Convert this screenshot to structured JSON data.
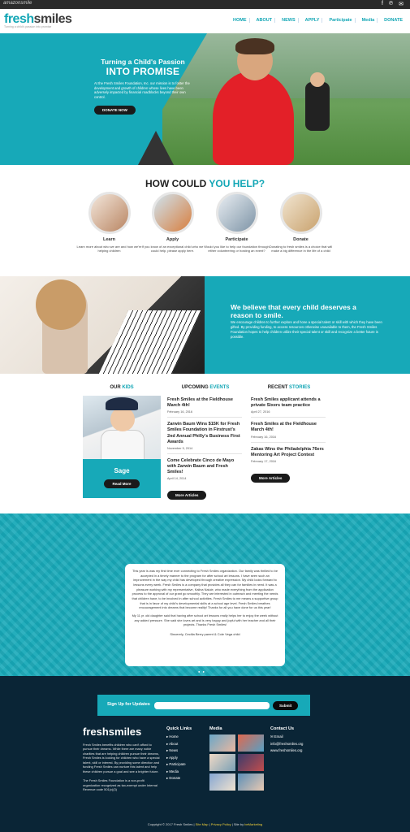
{
  "topbar": {
    "brand": "amazonsmile",
    "social": [
      "f",
      "℗",
      "✉"
    ]
  },
  "logo": {
    "word_a": "fresh",
    "word_b": "smiles",
    "tagline": "Turning a child's passion into promise"
  },
  "nav": [
    "HOME",
    "ABOUT",
    "NEWS",
    "APPLY",
    "Participate",
    "Media",
    "DONATE"
  ],
  "hero": {
    "line1": "Turning a Child's Passion",
    "line2": "INTO PROMISE",
    "body": "At the Fresh Smiles Foundation, Inc. our mission is to foster the development and growth of children whose lives have been adversely impacted by financial roadblocks beyond their own control.",
    "button": "DONATE NOW"
  },
  "help": {
    "title_a": "HOW COULD ",
    "title_b": "YOU HELP?",
    "items": [
      {
        "label": "Learn",
        "desc": "Learn more about who we are and how we're helping children"
      },
      {
        "label": "Apply",
        "desc": "If you know of an exceptional child who we could help, please apply here."
      },
      {
        "label": "Participate",
        "desc": "Would you like to help our foundation through either volunteering or hosting an event?"
      },
      {
        "label": "Donate",
        "desc": "Donating to fresh smiles is a choice that will make a big difference in the life of a child"
      }
    ]
  },
  "believe": {
    "heading": "We believe that every child deserves a reason to smile.",
    "body": "We encourage children to further explore and hone a special talent or skill with which they have been gifted. By providing funding, to access resources otherwise unavailable to them, the Fresh Smiles Foundation hopes to help children utilize their special talent or skill and recognize a better future is possible."
  },
  "news": {
    "kids_title_a": "OUR ",
    "kids_title_b": "KIDS",
    "kid_name": "Sage",
    "kid_button": "Read More",
    "events_title_a": "UPCOMING ",
    "events_title_b": "EVENTS",
    "events": [
      {
        "title": "Fresh Smiles at the Fieldhouse March 4th!",
        "date": "February 16, 2016"
      },
      {
        "title": "Zarwin Baum Wins $15K for Fresh Smiles Foundation in Firstrust's 2nd Annual Philly's Business First Awards",
        "date": "November 5, 2014"
      },
      {
        "title": "Come Celebrate Cinco de Mayo with Zarwin Baum and Fresh Smiles!",
        "date": "April 14, 2014"
      }
    ],
    "events_button": "More Articles",
    "stories_title_a": "RECENT ",
    "stories_title_b": "STORIES",
    "stories": [
      {
        "title": "Fresh Smiles applicant attends a private Sixers team practice",
        "date": "April 27, 2016"
      },
      {
        "title": "Fresh Smiles at the Fieldhouse March 4th!",
        "date": "February 16, 2016"
      },
      {
        "title": "Zakas Wins the Philadelphia 76ers Mentoring Art Project Contest",
        "date": "February 17, 2016"
      }
    ],
    "stories_button": "More Articles"
  },
  "testimonial": {
    "quote1": "This year is was my first time ever connecting to Fresh Smiles organization. Our family was thrilled to be accepted in a timely manner to the program for after school art lessons. I have seen such an improvement in the way my child has developed through creative expression. My child looks forward to lessons every week. Fresh Smiles is a company that provides all they can for families in need. It was a pleasure working with my representative, Kalina Nalule, who made everything from the application process to the approval of our grant go smoothly. They are interested in outreach and meeting the needs that children have, to be involved in after school activities. Fresh Smiles to me means a supportive group that is in favor of my child's developmental skills at a school age level. Fresh Smiles breathes encouragement into dreams that become reality! Thanks for all you have done for us this year!",
    "quote2": "My 11 yr. old daughter said that having after school art lessons really helps her to enjoy the week without any added pressure. She said she loves art and is very happy and joyful with her teacher and all their projects. Thanks Fresh Smiles!",
    "signature": "Sincerely, Cecilia Berry parent & Cole Vega child",
    "dots": "● ●"
  },
  "signup": {
    "label": "Sign Up for Updates",
    "placeholder": "",
    "button": "Submit"
  },
  "footer": {
    "logo_a": "fresh",
    "logo_b": "smiles",
    "about1": "Fresh Smiles benefits children who can't afford to pursue their dreams. While there are many noble charities that are helping children pursue their dreams, Fresh Smiles is looking for children who have a special talent, skill or interest. By providing some direction and funding Fresh Smiles can nurture this talent and help these children pursue a goal and see a brighter future.",
    "about2": "The Fresh Smiles Foundation is a non-profit organization recognized as tax-exempt under Internal Revenue code 501(c)(3)",
    "quick_links_title": "Quick Links",
    "quick_links": [
      "▸ Home",
      "▸ About",
      "▸ News",
      "▸ Apply",
      "▸ Participate",
      "▸ Media",
      "▸ Donate"
    ],
    "media_title": "Media",
    "contact_title": "Contact Us",
    "contact": [
      "✉ Email",
      "info@freshsmiles.org",
      "www.freshsmiles.org"
    ],
    "copy_a": "Copyright © 2017 Fresh Smiles | ",
    "copy_b": "Site Map",
    "copy_c": " | ",
    "copy_d": "Privacy Policy",
    "copy_e": " | Site by ",
    "copy_f": "beMarketing"
  }
}
